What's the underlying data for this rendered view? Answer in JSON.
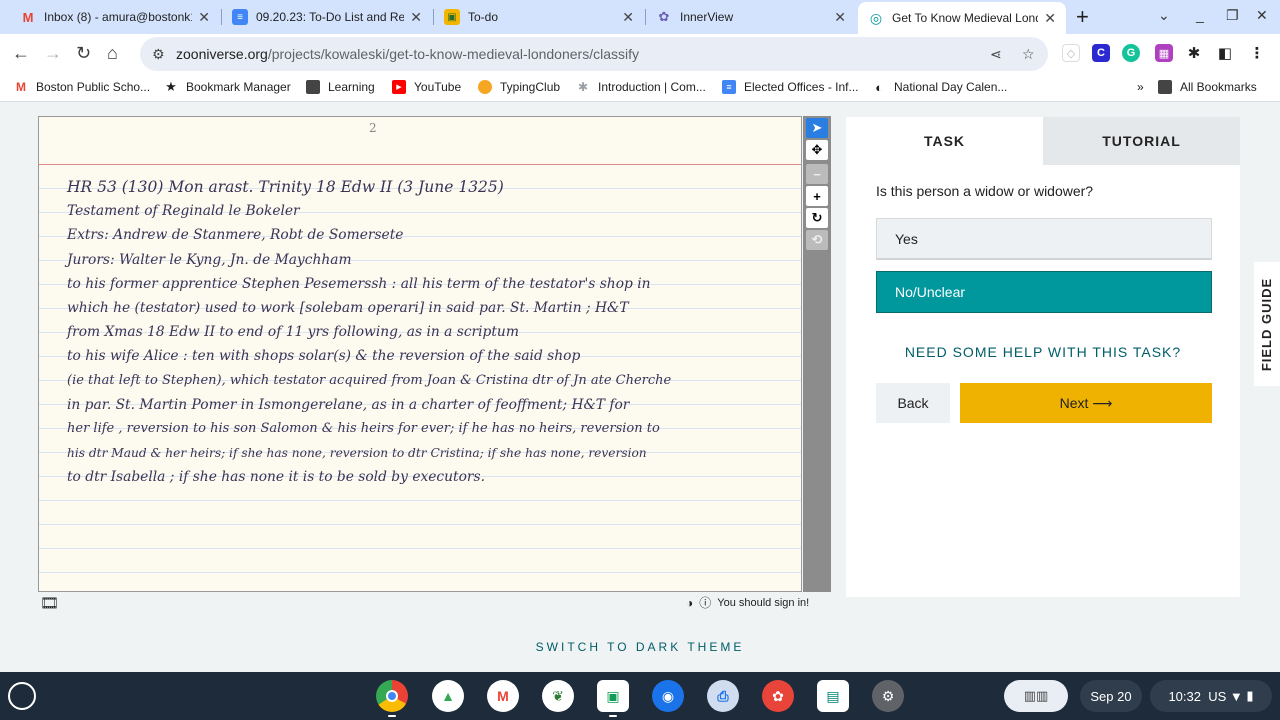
{
  "browser": {
    "tabs": [
      {
        "title": "Inbox (8) - amura@bostonk1",
        "icon": "gmail-icon",
        "color": "#ea4335",
        "glyph": "M"
      },
      {
        "title": "09.20.23: To-Do List and Re",
        "icon": "docs-icon",
        "color": "#4285f4",
        "glyph": "≡"
      },
      {
        "title": "To-do",
        "icon": "classroom-icon",
        "color": "#f2b600",
        "glyph": "▣"
      },
      {
        "title": "InnerView",
        "icon": "innerview-icon",
        "color": "#6b5fb5",
        "glyph": "✿"
      },
      {
        "title": "Get To Know Medieval Lond",
        "icon": "zooniverse-icon",
        "color": "#00979d",
        "glyph": "◎"
      }
    ],
    "new_tab": "+",
    "url_host": "zooniverse.org",
    "url_path": "/projects/kowaleski/get-to-know-medieval-londoners/classify",
    "bookmarks": [
      {
        "label": "Boston Public Scho...",
        "icon": "gmail-icon",
        "color": "#ea4335",
        "glyph": "M"
      },
      {
        "label": "Bookmark Manager",
        "icon": "star-icon",
        "color": "#1f1f1f",
        "glyph": "★"
      },
      {
        "label": "Learning",
        "icon": "folder-icon",
        "color": "#444",
        "glyph": "▬"
      },
      {
        "label": "YouTube",
        "icon": "youtube-icon",
        "color": "#ff0000",
        "glyph": "▶"
      },
      {
        "label": "TypingClub",
        "icon": "typingclub-icon",
        "color": "#f5a623",
        "glyph": "✋"
      },
      {
        "label": "Introduction | Com...",
        "icon": "web-icon",
        "color": "#9aa0a6",
        "glyph": "✱"
      },
      {
        "label": "Elected Offices - Inf...",
        "icon": "docs-icon",
        "color": "#4285f4",
        "glyph": "≡"
      },
      {
        "label": "National Day Calen...",
        "icon": "globe-icon",
        "color": "#1f1f1f",
        "glyph": "◐"
      }
    ],
    "more": "»",
    "all_bookmarks": "All Bookmarks"
  },
  "document": {
    "page_number": "2",
    "lines": [
      "HR 53 (130)      Mon   arast.  Trinity   18 Edw II     (3 June 1325)",
      "Testament  of   Reginald  le  Bokeler",
      "Extrs:  Andrew  de  Stanmere,  Robt de  Somersete",
      "Jurors:  Walter le  Kyng,  Jn. de  Maychham",
      "to  his former apprentice   Stephen Pesemerssh :  all  his  term  of  the testator's  shop  in",
      "which  he (testator)  used to  work  [solebam operari]  in  said  par.  St. Martin ;  H&T",
      "from  Xmas  18 Edw II  to  end  of  11 yrs  following,   as  in   a  scriptum",
      "to  his  wife  Alice :  ten  with  shops  solar(s)  &  the  reversion  of  the  said  shop",
      "(ie that left to Stephen),  which  testator  acquired  from  Joan  &  Cristina  dtr of  Jn ate Cherche",
      "in  par.  St. Martin  Pomer   in  Ismongerelane,  as  in  a  charter  of  feoffment;  H&T for",
      "her  life ,  reversion to  his  son   Salomon   &  his heirs  for  ever;  if  he has  no  heirs,  reversion to",
      "his dtr  Maud  &  her  heirs;  if  she  has  none,  reversion  to  dtr  Cristina;  if  she  has  none,  reversion",
      "to  dtr  Isabella ;   if  she  has  none   it  is   to  be  sold   by  executors."
    ]
  },
  "viewer": {
    "sign_in_notice": "You should sign in!"
  },
  "task": {
    "tabs": {
      "task": "TASK",
      "tutorial": "TUTORIAL"
    },
    "question": "Is this person a widow or widower?",
    "answers": {
      "yes": "Yes",
      "no": "No/Unclear"
    },
    "selected": "No/Unclear",
    "help": "NEED SOME HELP WITH THIS TASK?",
    "back": "Back",
    "next": "Next ⟶",
    "accent": "#00979d",
    "next_color": "#f0b200"
  },
  "field_guide": "FIELD GUIDE",
  "dark_theme": "SWITCH TO DARK THEME",
  "shelf": {
    "date": "Sep 20",
    "time": "10:32",
    "locale": "US"
  }
}
